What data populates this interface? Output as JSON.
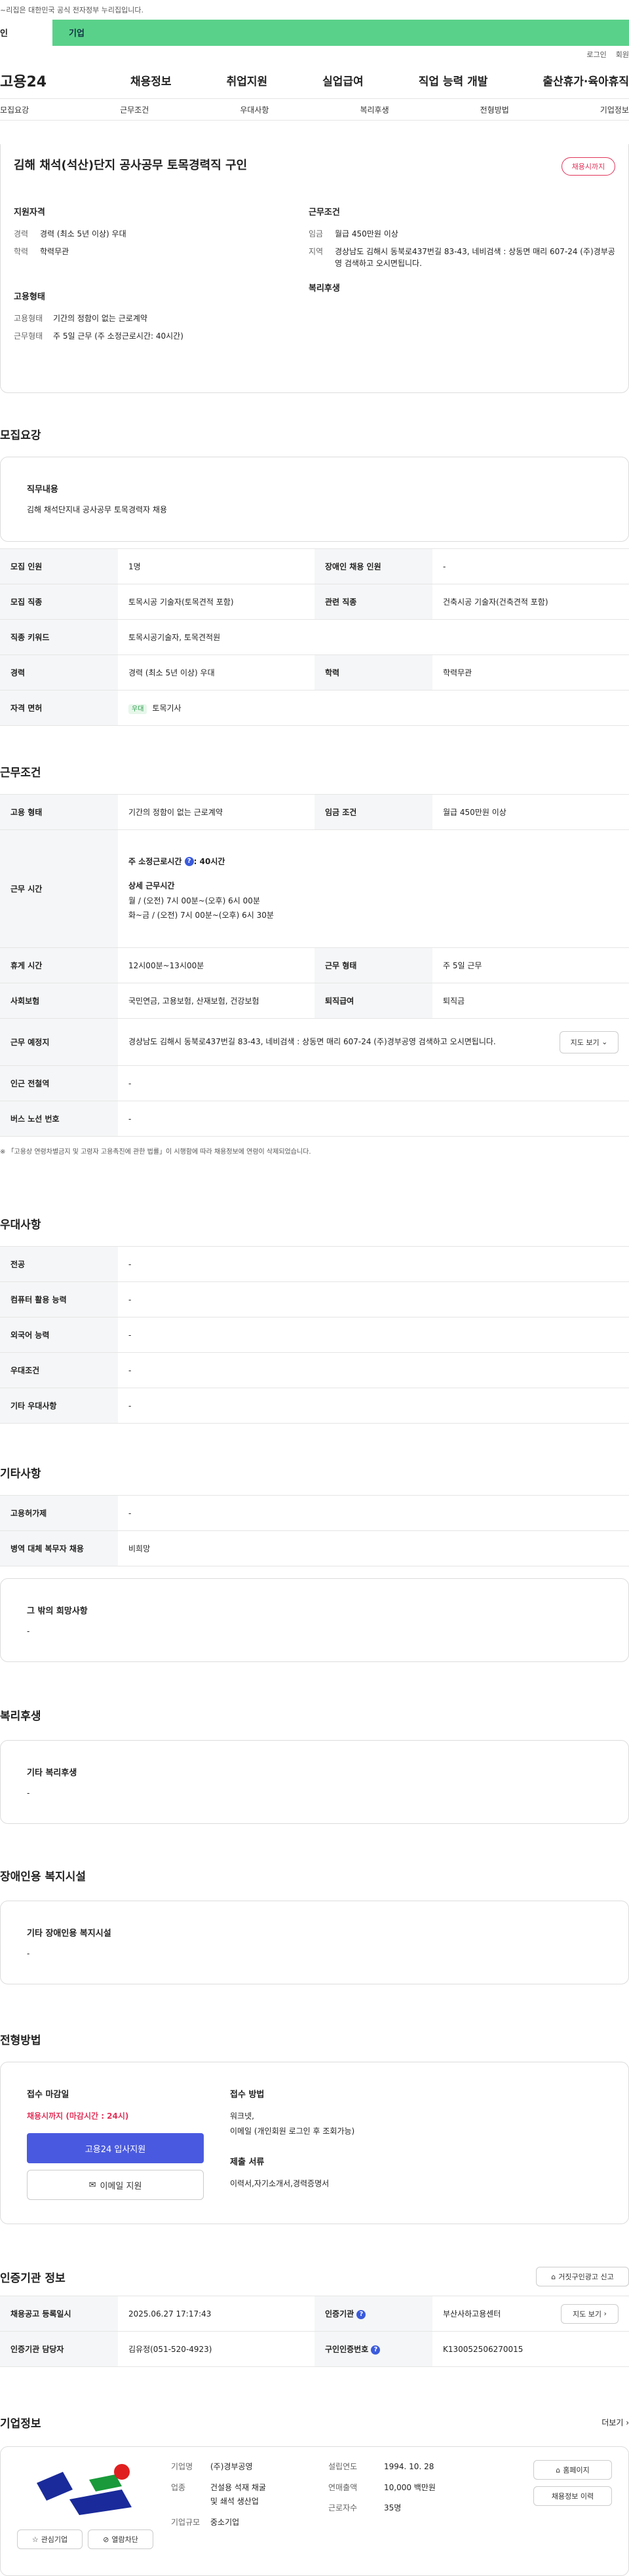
{
  "gov": {
    "text": "~리집은 대한민국 공식 전자정부 누리집입니다."
  },
  "tabs": {
    "t1": "인",
    "t2": "기업"
  },
  "top": {
    "login": "로그인",
    "join": "회원"
  },
  "gnb": {
    "logo": "고용24",
    "m1": "채용정보",
    "m2": "취업지원",
    "m3": "실업급여",
    "m4": "직업 능력 개발",
    "m5": "출산휴가·육아휴직"
  },
  "lnb": [
    "모집요강",
    "근무조건",
    "우대사항",
    "복리후생",
    "전형방법",
    "기업정보"
  ],
  "job": {
    "title": "김해 채석(석산)단지 공사공무 토목경력직 구인",
    "status": "채용시까지",
    "qual_h": "지원자격",
    "career_k": "경력",
    "career_v": "경력 (최소 5년 이상) 우대",
    "edu_k": "학력",
    "edu_v": "학력무관",
    "cond_h": "근무조건",
    "wage_k": "임금",
    "wage_v": "월급 450만원 이상",
    "loc_k": "지역",
    "loc_v": "경상남도 김해시 동북로437번길 83-43, 네비검색 : 상동면 매리 607-24 (주)경부공영 검색하고 오시면됩니다.",
    "emp_h": "고용형태",
    "etype_k": "고용형태",
    "etype_v": "기간의 정함이 없는 근로계약",
    "work_k": "근무형태",
    "work_v": "주 5일 근무 (주 소정근로시간: 40시간)",
    "welfare_h": "복리후생"
  },
  "recruit": {
    "title": "모집요강",
    "duty_h": "직무내용",
    "duty_v": "김해 채석단지내 공사공무 토목경력자 채용",
    "rows": [
      [
        "모집 인원",
        "1명",
        "장애인 채용 인원",
        "-"
      ],
      [
        "모집 직종",
        "토목시공 기술자(토목견적 포함)",
        "관련 직종",
        "건축시공 기술자(건축견적 포함)"
      ]
    ],
    "kw_k": "직종 키워드",
    "kw_v": "토목시공기술자, 토목견적원",
    "car_k": "경력",
    "car_v": "경력 (최소 5년 이상) 우대",
    "edu_k": "학력",
    "edu_v": "학력무관",
    "lic_k": "자격 면허",
    "lic_badge": "우대",
    "lic_v": "토목기사"
  },
  "cond": {
    "title": "근무조건",
    "emp_k": "고용 형태",
    "emp_v": "기간의 정함이 없는 근로계약",
    "wage_k": "임금 조건",
    "wage_v": "월급 450만원 이상",
    "time_k": "근무 시간",
    "hours_label": "주 소정근로시간",
    "hours_v": ": 40시간",
    "detail_h": "상세 근무시간",
    "d1": "월  / (오전) 7시 00분~(오후) 6시 00분",
    "d2": "화~금 / (오전) 7시 00분~(오후) 6시 30분",
    "rest_k": "휴게 시간",
    "rest_v": "12시00분~13시00분",
    "wtype_k": "근무 형태",
    "wtype_v": "주 5일 근무",
    "ins_k": "사회보험",
    "ins_v": "국민연금, 고용보험, 산재보험, 건강보험",
    "ret_k": "퇴직급여",
    "ret_v": "퇴직금",
    "place_k": "근무 예정지",
    "place_v": "경상남도 김해시 동북로437번길 83-43, 네비검색 : 상동면 매리 607-24 (주)경부공영 검색하고 오시면됩니다.",
    "map_btn": "지도 보기",
    "sub_k": "인근 전철역",
    "sub_v": "-",
    "bus_k": "버스 노선 번호",
    "bus_v": "-",
    "note": "「고용상 연령차별금지 및 고령자 고용촉진에 관한 법률」이 시행함에 따라 채용정보에 연령이 삭제되었습니다."
  },
  "pref": {
    "title": "우대사항",
    "rows": [
      [
        "전공",
        "-"
      ],
      [
        "컴퓨터 활용 능력",
        "-"
      ],
      [
        "외국어 능력",
        "-"
      ],
      [
        "우대조건",
        "-"
      ],
      [
        "기타 우대사항",
        "-"
      ]
    ]
  },
  "etc": {
    "title": "기타사항",
    "rows": [
      [
        "고용허가제",
        "-"
      ],
      [
        "병역 대체 복무자 채용",
        "비희망"
      ]
    ],
    "box_h": "그 밖의 희망사항",
    "box_v": "-"
  },
  "welfare": {
    "title": "복리후생",
    "box_h": "기타 복리후생",
    "box_v": "-"
  },
  "dis": {
    "title": "장애인용 복지시설",
    "box_h": "기타 장애인용 복지시설",
    "box_v": "-"
  },
  "proc": {
    "title": "전형방법",
    "dl_h": "접수 마감일",
    "dl_v": "채용시까지 (마감시간 : 24시)",
    "apply_btn": "고용24 입사지원",
    "email_btn": "이메일 지원",
    "method_h": "접수 방법",
    "method_v1": "워크넷,",
    "method_v2": "이메일 (개인회원 로그인 후 조회가능)",
    "docs_h": "제출 서류",
    "docs_v": "이력서,자기소개서,경력증명서"
  },
  "auth": {
    "title": "인증기관 정보",
    "report_btn": "거짓구인광고 신고",
    "reg_k": "채용공고 등록일시",
    "reg_v": "2025.06.27 17:17:43",
    "org_k": "인증기관",
    "org_v": "부산사하고용센터",
    "map_btn": "지도 보기",
    "mgr_k": "인증기관 담당자",
    "mgr_v": "김유정(051-520-4923)",
    "num_k": "구인인증번호",
    "num_v": "K130052506270015"
  },
  "company": {
    "title": "기업정보",
    "more": "더보기",
    "fav_btn": "관심기업",
    "block_btn": "열람차단",
    "name_k": "기업명",
    "name_v": "(주)경부공영",
    "ind_k": "업종",
    "ind_v1": "건설용 석재 채굴",
    "ind_v2": "및 쇄석 생산업",
    "size_k": "기업규모",
    "size_v": "중소기업",
    "est_k": "설립연도",
    "est_v": "1994. 10. 28",
    "sales_k": "연매출액",
    "sales_v": "10,000 백만원",
    "emp_k": "근로자수",
    "emp_v": "35명",
    "home_btn": "홈페이지",
    "hist_btn": "채용정보 이력"
  }
}
